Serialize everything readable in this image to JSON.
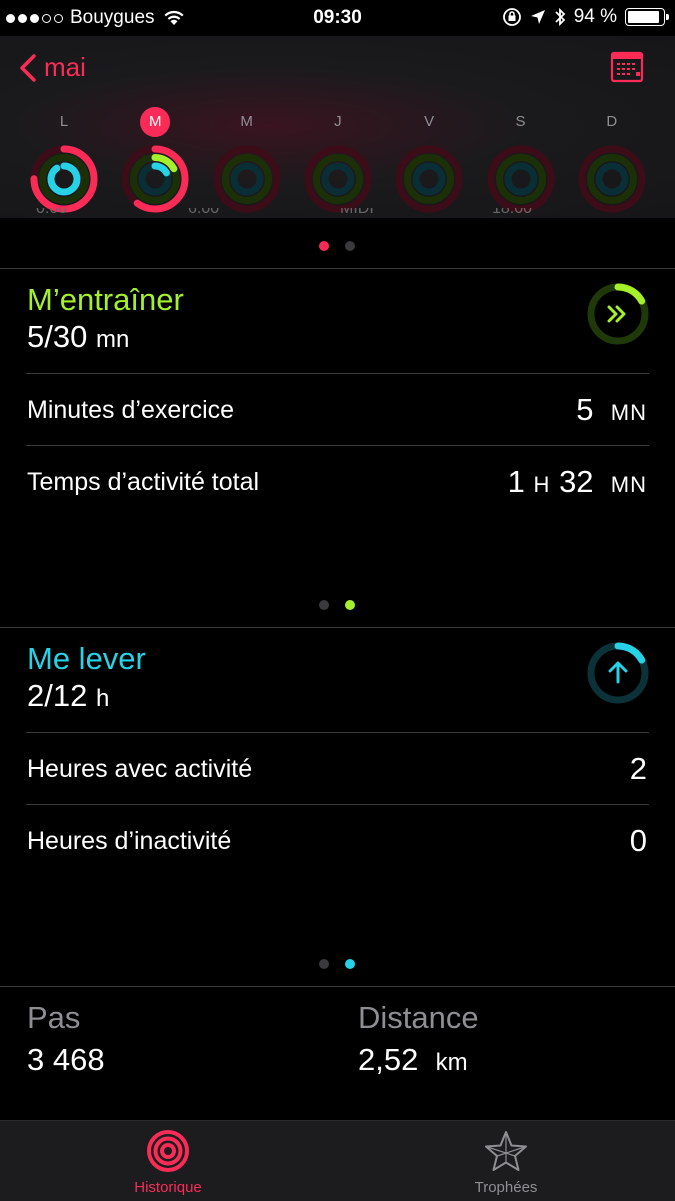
{
  "status": {
    "carrier": "Bouygues",
    "time": "09:30",
    "battery": "94 %",
    "battery_level": 0.94,
    "signal_dots": [
      true,
      true,
      true,
      false,
      false
    ]
  },
  "header": {
    "back_label": "mai",
    "calendar_icon": "calendar-icon",
    "accent": "#fa2c57"
  },
  "week": {
    "days": [
      "L",
      "M",
      "M",
      "J",
      "V",
      "S",
      "D"
    ],
    "selected_index": 1,
    "rings": [
      {
        "move": 0.75,
        "exercise": 0.0,
        "stand": 0.9
      },
      {
        "move": 0.6,
        "exercise": 0.17,
        "stand": 0.17
      },
      {
        "move": 0,
        "exercise": 0,
        "stand": 0
      },
      {
        "move": 0,
        "exercise": 0,
        "stand": 0
      },
      {
        "move": 0,
        "exercise": 0,
        "stand": 0
      },
      {
        "move": 0,
        "exercise": 0,
        "stand": 0
      },
      {
        "move": 0,
        "exercise": 0,
        "stand": 0
      }
    ]
  },
  "chart_ticks": [
    "0:00",
    "6:00",
    "MIDI",
    "18:00"
  ],
  "exercise": {
    "title": "M’entraîner",
    "value": "5/30",
    "unit": "mn",
    "color": "#a4f02a",
    "progress": 0.17,
    "rows": [
      {
        "label": "Minutes d’exercice",
        "num": "5",
        "unit": "MN"
      },
      {
        "label": "Temps d’activité total",
        "num1": "1",
        "unit1": "H",
        "num2": "32",
        "unit2": "MN"
      }
    ]
  },
  "stand": {
    "title": "Me lever",
    "value": "2/12",
    "unit": "h",
    "color": "#27d1e6",
    "progress": 0.17,
    "rows": [
      {
        "label": "Heures avec activité",
        "value": "2"
      },
      {
        "label": "Heures d’inactivité",
        "value": "0"
      }
    ]
  },
  "stats": {
    "steps_label": "Pas",
    "steps_value": "3 468",
    "distance_label": "Distance",
    "distance_value": "2,52",
    "distance_unit": "km"
  },
  "tabs": [
    {
      "label": "Historique",
      "icon": "activity-rings-icon",
      "active": true
    },
    {
      "label": "Trophées",
      "icon": "star-icon",
      "active": false
    }
  ]
}
